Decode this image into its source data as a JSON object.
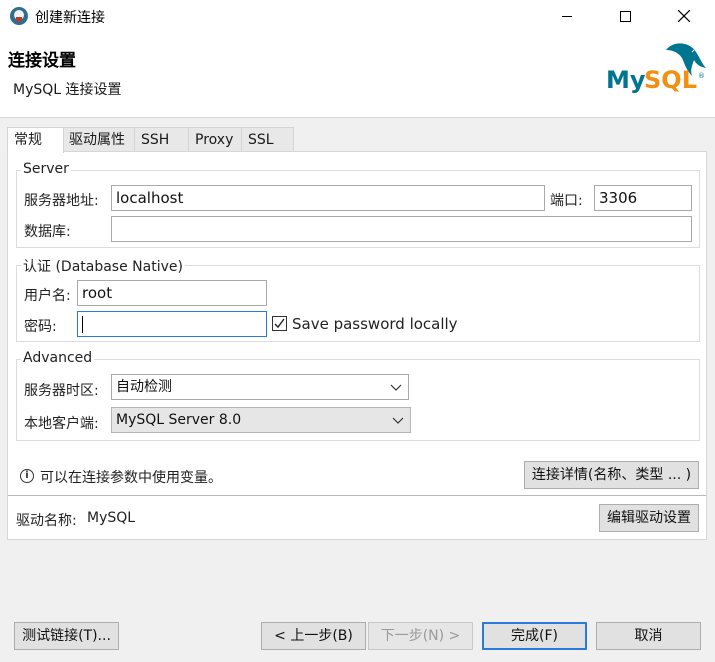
{
  "window": {
    "title": "创建新连接",
    "minimize_icon": "minimize-icon",
    "maximize_icon": "maximize-icon",
    "close_icon": "close-icon"
  },
  "header": {
    "title": "连接设置",
    "subtitle": "MySQL 连接设置",
    "logo_text": "MySQL",
    "logo_mark": "®",
    "logo_colors": {
      "my": "#00758f",
      "sql": "#f29111"
    }
  },
  "tabs": [
    {
      "label": "常规",
      "active": true
    },
    {
      "label": "驱动属性",
      "active": false
    },
    {
      "label": "SSH",
      "active": false
    },
    {
      "label": "Proxy",
      "active": false
    },
    {
      "label": "SSL",
      "active": false
    }
  ],
  "server": {
    "title": "Server",
    "host_label": "服务器地址:",
    "host_value": "localhost",
    "port_label": "端口:",
    "port_value": "3306",
    "database_label": "数据库:",
    "database_value": ""
  },
  "auth": {
    "title": "认证 (Database Native)",
    "username_label": "用户名:",
    "username_value": "root",
    "password_label": "密码:",
    "password_value": "",
    "save_password_label": "Save password locally",
    "save_password_checked": true
  },
  "advanced": {
    "title": "Advanced",
    "timezone_label": "服务器时区:",
    "timezone_value": "自动检测",
    "client_label": "本地客户端:",
    "client_value": "MySQL Server 8.0"
  },
  "info": {
    "text": "可以在连接参数中使用变量。",
    "details_button": "连接详情(名称、类型 ... )"
  },
  "driver": {
    "label": "驱动名称:",
    "value": "MySQL",
    "edit_button": "编辑驱动设置"
  },
  "footer": {
    "test_button": "测试链接(T)...",
    "prev_button": "< 上一步(B)",
    "next_button": "下一步(N) >",
    "finish_button": "完成(F)",
    "cancel_button": "取消"
  },
  "colors": {
    "focus_border": "#2a7bd6",
    "window_bg": "#f0f0f0",
    "panel_bg": "#ffffff"
  }
}
